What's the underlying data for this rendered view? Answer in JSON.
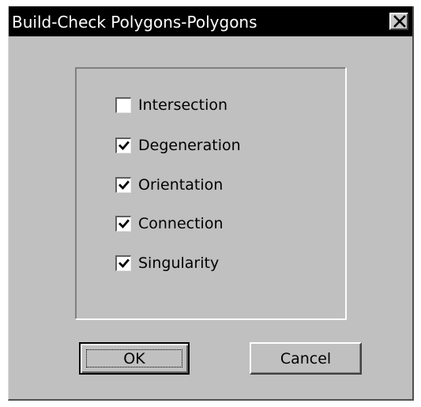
{
  "window": {
    "title": "Build-Check Polygons-Polygons",
    "close_icon": "close-icon"
  },
  "options": [
    {
      "label": "Intersection",
      "checked": false
    },
    {
      "label": "Degeneration",
      "checked": true
    },
    {
      "label": "Orientation",
      "checked": true
    },
    {
      "label": "Connection",
      "checked": true
    },
    {
      "label": "Singularity",
      "checked": true
    }
  ],
  "buttons": {
    "ok_label": "OK",
    "cancel_label": "Cancel"
  },
  "colors": {
    "dialog_face": "#c0c0c0",
    "titlebar": "#000000",
    "title_text": "#ffffff"
  }
}
